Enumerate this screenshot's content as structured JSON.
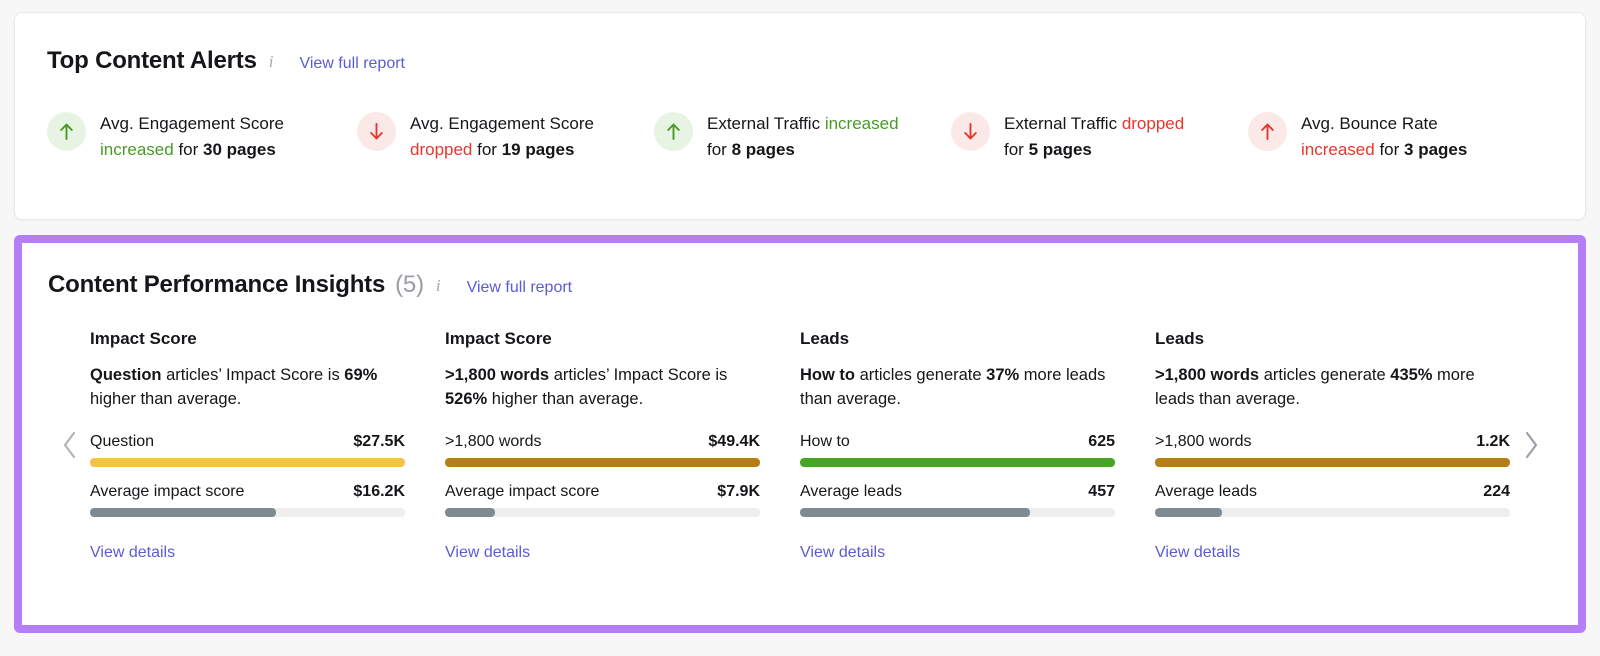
{
  "alerts_panel": {
    "title": "Top Content Alerts",
    "info_icon": "info-icon",
    "report_link": "View full report",
    "items": [
      {
        "direction": "up",
        "tone": "good",
        "metric": "Avg. Engagement Score",
        "change_word": "increased",
        "middle": " for ",
        "count": "30 pages",
        "layout": "metric-first"
      },
      {
        "direction": "down",
        "tone": "bad",
        "metric": "Avg. Engagement Score",
        "change_word": "dropped",
        "middle": " for ",
        "count": "19 pages",
        "layout": "metric-first"
      },
      {
        "direction": "up",
        "tone": "good",
        "metric": "External Traffic",
        "change_word": "increased",
        "middle": "for ",
        "count": "8 pages",
        "layout": "inline"
      },
      {
        "direction": "down",
        "tone": "bad",
        "metric": "External Traffic",
        "change_word": "dropped",
        "middle": "for ",
        "count": "5 pages",
        "layout": "inline"
      },
      {
        "direction": "up",
        "tone": "bad",
        "metric": "Avg. Bounce Rate",
        "change_word": "increased",
        "middle": " for ",
        "count": "3 pages",
        "layout": "metric-first"
      }
    ]
  },
  "insights_panel": {
    "title": "Content Performance Insights",
    "count": "(5)",
    "info_icon": "info-icon",
    "report_link": "View full report",
    "prev_label": "previous-insight",
    "next_label": "next-insight",
    "cards": [
      {
        "kpi": "Impact Score",
        "desc_bold_1": "Question",
        "desc_mid_1": " articles’ Impact Score is ",
        "desc_bold_2": "69%",
        "desc_tail": " higher than average.",
        "primary_label": "Question",
        "primary_value": "$27.5K",
        "primary_pct": 100,
        "primary_color": "#f4c14b",
        "avg_label": "Average impact score",
        "avg_value": "$16.2K",
        "avg_pct": 59,
        "avg_color": "#7e8b90",
        "details_link": "View details"
      },
      {
        "kpi": "Impact Score",
        "desc_bold_1": ">1,800 words",
        "desc_mid_1": " articles’ Impact Score is ",
        "desc_bold_2": "526%",
        "desc_tail": " higher than average.",
        "primary_label": ">1,800 words",
        "primary_value": "$49.4K",
        "primary_pct": 100,
        "primary_color": "#b57f16",
        "avg_label": "Average impact score",
        "avg_value": "$7.9K",
        "avg_pct": 16,
        "avg_color": "#7e8b90",
        "details_link": "View details"
      },
      {
        "kpi": "Leads",
        "desc_bold_1": "How to",
        "desc_mid_1": " articles generate ",
        "desc_bold_2": "37%",
        "desc_tail": " more leads than average.",
        "primary_label": "How to",
        "primary_value": "625",
        "primary_pct": 100,
        "primary_color": "#46a521",
        "avg_label": "Average leads",
        "avg_value": "457",
        "avg_pct": 73,
        "avg_color": "#7e8b90",
        "details_link": "View details"
      },
      {
        "kpi": "Leads",
        "desc_bold_1": ">1,800 words",
        "desc_mid_1": " articles generate ",
        "desc_bold_2": "435%",
        "desc_tail": " more leads than average.",
        "primary_label": ">1,800 words",
        "primary_value": "1.2K",
        "primary_pct": 100,
        "primary_color": "#b57f16",
        "avg_label": "Average leads",
        "avg_value": "224",
        "avg_pct": 19,
        "avg_color": "#7e8b90",
        "details_link": "View details"
      }
    ]
  },
  "colors": {
    "link": "#5b5bd6",
    "positive": "#4a9a28",
    "negative": "#e5372e",
    "highlight_border": "#b57ef7"
  }
}
